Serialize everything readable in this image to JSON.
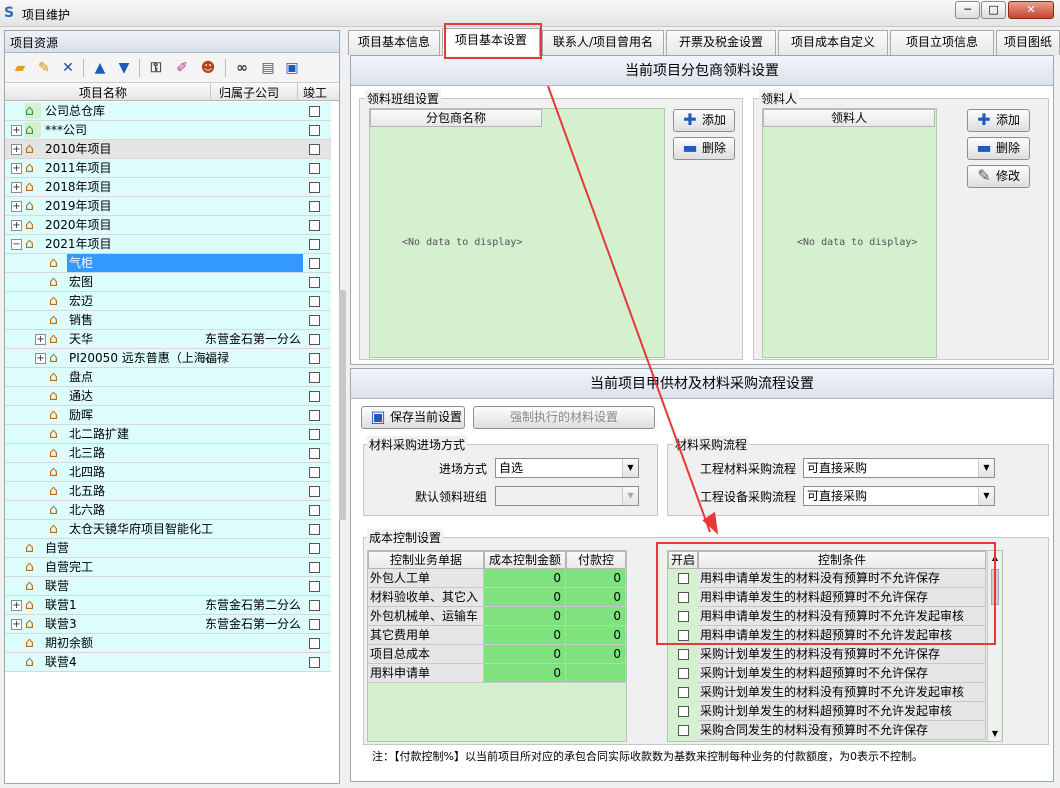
{
  "window": {
    "title": "项目维护",
    "min": "─",
    "max": "□",
    "close": "✕"
  },
  "left": {
    "header": "项目资源",
    "toolbar": [
      "folder-add-icon",
      "folder-edit-icon",
      "delete-icon",
      "up-arrow-icon",
      "down-arrow-icon",
      "key-icon",
      "brush-icon",
      "users-icon",
      "binoculars-icon",
      "document-icon",
      "save-icon"
    ],
    "columns": {
      "name": "项目名称",
      "company": "归属子公司",
      "done": "竣工"
    },
    "rows": [
      {
        "name": "公司总仓库",
        "company": "",
        "level": 0,
        "expander": false,
        "icon": "green",
        "bg": "cyan"
      },
      {
        "name": "***公司",
        "company": "",
        "level": 0,
        "expander": true,
        "icon": "green",
        "bg": "cyan"
      },
      {
        "name": "2010年项目",
        "company": "",
        "level": 0,
        "expander": true,
        "icon": "orange",
        "bg": "gray"
      },
      {
        "name": "2011年项目",
        "company": "",
        "level": 0,
        "expander": true,
        "icon": "orange",
        "bg": "cyan"
      },
      {
        "name": "2018年项目",
        "company": "",
        "level": 0,
        "expander": true,
        "icon": "orange",
        "bg": "cyan"
      },
      {
        "name": "2019年项目",
        "company": "",
        "level": 0,
        "expander": true,
        "icon": "orange",
        "bg": "cyan"
      },
      {
        "name": "2020年项目",
        "company": "",
        "level": 0,
        "expander": true,
        "icon": "orange",
        "bg": "cyan"
      },
      {
        "name": "2021年项目",
        "company": "",
        "level": 0,
        "expander": true,
        "icon": "orange",
        "bg": "cyan",
        "open": true
      },
      {
        "name": "气柜",
        "company": "",
        "level": 1,
        "expander": false,
        "icon": "orange",
        "bg": "cyan",
        "selected": true
      },
      {
        "name": "宏图",
        "company": "",
        "level": 1,
        "expander": false,
        "icon": "orange",
        "bg": "cyan"
      },
      {
        "name": "宏迈",
        "company": "",
        "level": 1,
        "expander": false,
        "icon": "orange",
        "bg": "cyan"
      },
      {
        "name": "销售",
        "company": "",
        "level": 1,
        "expander": false,
        "icon": "orange",
        "bg": "cyan"
      },
      {
        "name": "天华",
        "company": "东营金石第一分么",
        "level": 1,
        "expander": true,
        "icon": "orange",
        "bg": "cyan"
      },
      {
        "name": "PI20050 远东普惠（上海、",
        "company": "福禄",
        "level": 1,
        "expander": true,
        "icon": "orange",
        "bg": "cyan"
      },
      {
        "name": "盘点",
        "company": "",
        "level": 1,
        "expander": false,
        "icon": "orange",
        "bg": "cyan"
      },
      {
        "name": "通达",
        "company": "",
        "level": 1,
        "expander": false,
        "icon": "orange",
        "bg": "cyan"
      },
      {
        "name": "励晖",
        "company": "",
        "level": 1,
        "expander": false,
        "icon": "orange",
        "bg": "cyan"
      },
      {
        "name": "北二路扩建",
        "company": "",
        "level": 1,
        "expander": false,
        "icon": "orange",
        "bg": "cyan"
      },
      {
        "name": "北三路",
        "company": "",
        "level": 1,
        "expander": false,
        "icon": "orange",
        "bg": "cyan"
      },
      {
        "name": "北四路",
        "company": "",
        "level": 1,
        "expander": false,
        "icon": "orange",
        "bg": "cyan"
      },
      {
        "name": "北五路",
        "company": "",
        "level": 1,
        "expander": false,
        "icon": "orange",
        "bg": "cyan"
      },
      {
        "name": "北六路",
        "company": "",
        "level": 1,
        "expander": false,
        "icon": "orange",
        "bg": "cyan"
      },
      {
        "name": "太仓天镜华府项目智能化工",
        "company": "",
        "level": 1,
        "expander": false,
        "icon": "orange",
        "bg": "cyan"
      },
      {
        "name": "自营",
        "company": "",
        "level": 0,
        "expander": false,
        "icon": "orange",
        "bg": "cyan"
      },
      {
        "name": "自营完工",
        "company": "",
        "level": 0,
        "expander": false,
        "icon": "orange",
        "bg": "cyan"
      },
      {
        "name": "联营",
        "company": "",
        "level": 0,
        "expander": false,
        "icon": "orange",
        "bg": "cyan"
      },
      {
        "name": "联营1",
        "company": "东营金石第二分么",
        "level": 0,
        "expander": true,
        "icon": "orange",
        "bg": "cyan"
      },
      {
        "name": "联营3",
        "company": "东营金石第一分么",
        "level": 0,
        "expander": true,
        "icon": "orange",
        "bg": "cyan"
      },
      {
        "name": "期初余额",
        "company": "",
        "level": 0,
        "expander": false,
        "icon": "orange",
        "bg": "cyan"
      },
      {
        "name": "联营4",
        "company": "",
        "level": 0,
        "expander": false,
        "icon": "orange",
        "bg": "cyan"
      }
    ]
  },
  "tabs": [
    "项目基本信息",
    "项目基本设置",
    "联系人/项目曾用名",
    "开票及税金设置",
    "项目成本自定义",
    "项目立项信息",
    "项目图纸"
  ],
  "active_tab": 1,
  "sec1": {
    "title": "当前项目分包商领料设置",
    "group_team": "领料班组设置",
    "team_col": "分包商名称",
    "group_person": "领料人",
    "person_col": "领料人",
    "nodata": "<No data to display>",
    "btn_add": "添加",
    "btn_del": "删除",
    "btn_edit": "修改"
  },
  "sec2": {
    "title": "当前项目甲供材及材料采购流程设置",
    "btn_save": "保存当前设置",
    "btn_force": "强制执行的材料设置",
    "grp_mode": "材料采购进场方式",
    "lbl_mode": "进场方式",
    "val_mode": "自选",
    "lbl_team": "默认领料班组",
    "val_team": "",
    "grp_flow": "材料采购流程",
    "lbl_eng": "工程材料采购流程",
    "val_eng": "可直接采购",
    "lbl_dev": "工程设备采购流程",
    "val_dev": "可直接采购",
    "grp_cost": "成本控制设置",
    "cost_cols": [
      "控制业务单据",
      "成本控制金额",
      "付款控制%"
    ],
    "cost_rows": [
      {
        "label": "外包人工单",
        "amount": "0",
        "pay": "0"
      },
      {
        "label": "材料验收单、其它入",
        "amount": "0",
        "pay": "0"
      },
      {
        "label": "外包机械单、运输车",
        "amount": "0",
        "pay": "0"
      },
      {
        "label": "其它费用单",
        "amount": "0",
        "pay": "0"
      },
      {
        "label": "项目总成本",
        "amount": "0",
        "pay": "0"
      },
      {
        "label": "用料申请单",
        "amount": "0",
        "pay": ""
      }
    ],
    "cond_cols": [
      "开启",
      "控制条件"
    ],
    "cond_rows": [
      "用料申请单发生的材料没有预算时不允许保存",
      "用料申请单发生的材料超预算时不允许保存",
      "用料申请单发生的材料没有预算时不允许发起审核",
      "用料申请单发生的材料超预算时不允许发起审核",
      "采购计划单发生的材料没有预算时不允许保存",
      "采购计划单发生的材料超预算时不允许保存",
      "采购计划单发生的材料没有预算时不允许发起审核",
      "采购计划单发生的材料超预算时不允许发起审核",
      "采购合同发生的材料没有预算时不允许保存"
    ],
    "note": "注：【付款控制%】以当前项目所对应的承包合同实际收款数为基数来控制每种业务的付款额度，为0表示不控制。"
  },
  "colors": {
    "accent_red": "#e53838",
    "cyan_row": "#ddfdfd",
    "green_cell": "#7fe27f",
    "select_blue": "#3399ff"
  }
}
